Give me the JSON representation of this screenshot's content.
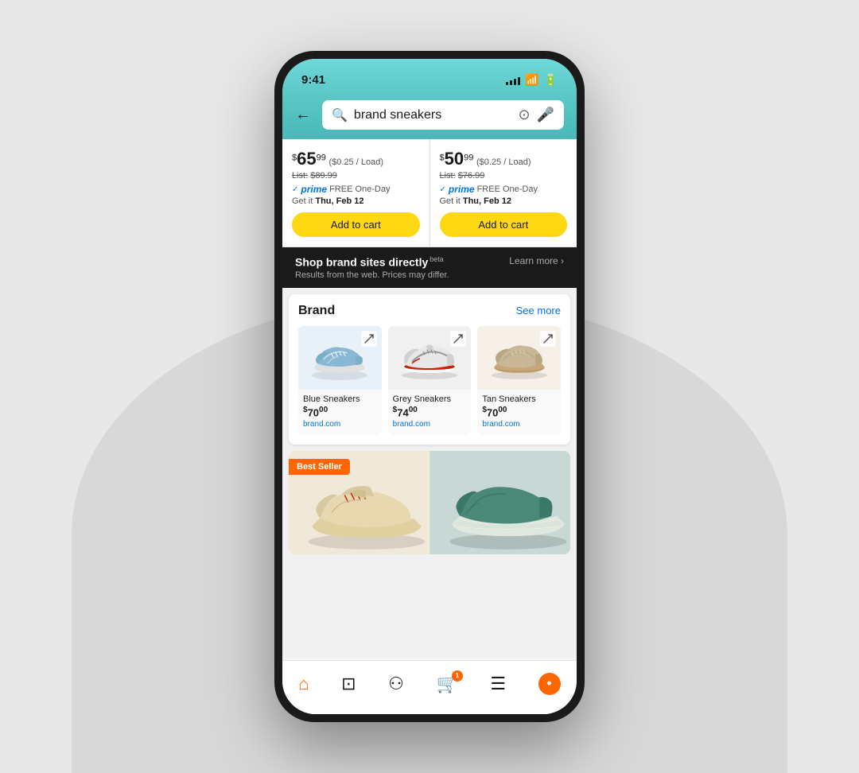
{
  "statusBar": {
    "time": "9:41",
    "signalBars": [
      3,
      5,
      7,
      9,
      11
    ],
    "wifiIcon": "wifi",
    "batteryIcon": "battery"
  },
  "searchBar": {
    "backLabel": "←",
    "query": "brand sneakers",
    "placeholder": "brand sneakers",
    "cameraIconLabel": "camera-search",
    "micIconLabel": "microphone"
  },
  "productCards": [
    {
      "priceDollar": "65",
      "priceCents": "99",
      "pricePerLoad": "($0.25 / Load)",
      "listLabel": "List:",
      "listPrice": "$89.99",
      "primeText": "prime",
      "primeOffer": "FREE One-Day",
      "getIt": "Get it",
      "deliveryDay": "Thu, Feb 12",
      "addToCartLabel": "Add to cart"
    },
    {
      "priceDollar": "50",
      "priceCents": "99",
      "pricePerLoad": "($0.25 / Load)",
      "listLabel": "List:",
      "listPrice": "$76.99",
      "primeText": "prime",
      "primeOffer": "FREE One-Day",
      "getIt": "Get it",
      "deliveryDay": "Thu, Feb 12",
      "addToCartLabel": "Add to cart"
    }
  ],
  "brandSitesBanner": {
    "title": "Shop brand sites directly",
    "betaLabel": "beta",
    "subtitle": "Results from the web. Prices may differ.",
    "learnMoreLabel": "Learn more ›"
  },
  "brandSection": {
    "title": "Brand",
    "seeMoreLabel": "See more",
    "products": [
      {
        "name": "Blue Sneakers",
        "priceDollar": "70",
        "priceCents": "00",
        "site": "brand.com",
        "color": "#b8d4e8"
      },
      {
        "name": "Grey Sneakers",
        "priceDollar": "74",
        "priceCents": "00",
        "site": "brand.com",
        "color": "#e0e0e0"
      },
      {
        "name": "Tan Sneakers",
        "priceDollar": "70",
        "priceCents": "00",
        "site": "brand.com",
        "color": "#d4c4a0"
      }
    ]
  },
  "bestSeller": {
    "badgeLabel": "Best Seller",
    "item1Color": "#f0e8d0",
    "item2Color": "#c8d8d0"
  },
  "bottomNav": {
    "homeLabel": "home",
    "tvLabel": "tv",
    "personLabel": "person",
    "cartLabel": "cart",
    "cartCount": "1",
    "menuLabel": "menu",
    "amazonLabel": "amazon"
  }
}
